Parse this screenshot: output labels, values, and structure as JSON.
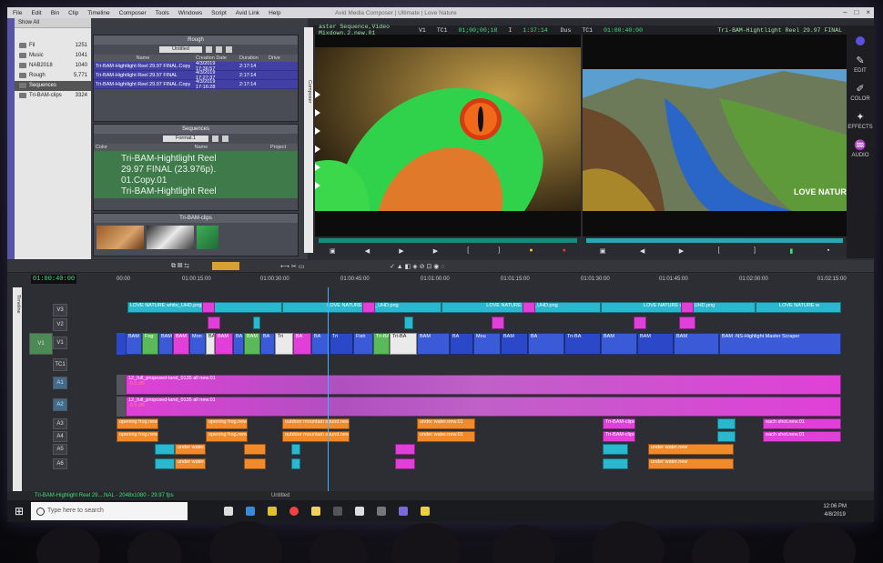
{
  "menu": [
    "File",
    "Edit",
    "Bin",
    "Clip",
    "Timeline",
    "Composer",
    "Tools",
    "Windows",
    "Script",
    "Avid Link",
    "Help"
  ],
  "window_title": "Avid Media Composer | Ultimate | Love Nature",
  "folders": {
    "show_all": "Show All",
    "items": [
      {
        "name": "Fil",
        "count": "1251"
      },
      {
        "name": "Music",
        "count": "1041"
      },
      {
        "name": "NAB2018",
        "count": "1040"
      },
      {
        "name": "Rough",
        "count": "5,771"
      },
      {
        "name": "Sequences",
        "count": ""
      },
      {
        "name": "Tri-BAM-clips",
        "count": "3324"
      }
    ]
  },
  "rough_bin": {
    "title": "Rough",
    "view": "Untitled",
    "columns": [
      "Name",
      "Creation Date",
      "Duration",
      "Drive"
    ],
    "rows": [
      {
        "name": "Tri-BAM-Hightlight Reel 29.97 FINAL.Copy.02",
        "date": "4/3/2019 17:36:57",
        "duration": "2:17:14"
      },
      {
        "name": "Tri-BAM-Hightlight Reel 29.97 FINAL",
        "date": "4/3/2019 17:27:37",
        "duration": "2:17:14"
      },
      {
        "name": "Tri-BAM-Hightlight Reel 29.97 FINAL.Copy.01",
        "date": "4/3/2019 17:16:28",
        "duration": "2:17:14"
      }
    ]
  },
  "sequences_bin": {
    "title": "Sequences",
    "view": "Format.1",
    "columns": [
      "Color",
      "Name",
      "Project"
    ],
    "selected_lines": [
      "Tri-BAM-Hightlight Reel",
      "29.97 FINAL (23.976p).",
      "01.Copy.01",
      "Tri-BAM-Hightlight Reel"
    ]
  },
  "clips_bin": {
    "title": "Tri-BAM-clips"
  },
  "composer_label": "Composer",
  "monitor_bar": {
    "source_seq": "aster Sequence,Video Mixdown,2.new.01",
    "v1": "V1",
    "tc1": "TC1",
    "source_tc": "01;00;00;18",
    "dur_label": "I",
    "duration": "1:37:14",
    "dur_label2": "Dus",
    "tc1b": "TC1",
    "record_tc": "01:00:40:00",
    "record_seq": "Tri-BAM-Hightlight Reel 29.97 FINAL"
  },
  "record_watermark": "LOVE NATURE",
  "sidebar": [
    {
      "label": "EDIT",
      "icon": "edit-icon",
      "glyph": "✎"
    },
    {
      "label": "COLOR",
      "icon": "color-icon",
      "glyph": "✐"
    },
    {
      "label": "EFFECTS",
      "icon": "effects-icon",
      "glyph": "✦"
    },
    {
      "label": "AUDIO",
      "icon": "audio-icon",
      "glyph": "♒"
    }
  ],
  "timeline": {
    "label": "Timeline",
    "timecode": "01:00:40:00",
    "ruler": [
      "00:00",
      "01:00:15:00",
      "01:00:30:00",
      "01:00:45:00",
      "01:01:00:00",
      "01:01:15:00",
      "01:01:30:00",
      "01:01:45:00",
      "01:02:00:00",
      "01:02:15:00"
    ],
    "tracks": [
      "V3",
      "V2",
      "V1",
      "TC1",
      "A1",
      "A2",
      "A3",
      "A4",
      "A5",
      "A6"
    ],
    "v3_titles": [
      "LOVE NATURE white_UHD.png",
      "LOVE NATURE white_UHD.png",
      "LOVE NATURE white_UHD.png",
      "LOVE NATURE white_UHD.png",
      "LOVE NATURE w"
    ],
    "audio_name": "12_full_proposed-land_0135 all new.01",
    "audio_gain": "-9.5 dB",
    "v1_labels": [
      "BAM",
      "Fog",
      "BAM",
      "BAM",
      "Mon",
      "BA",
      "BAM",
      "BA",
      "BAM",
      "BA",
      "Tri",
      "BA",
      "BA",
      "Tri",
      "Fish",
      "Tri-BA",
      "Tri-BA",
      "BAM",
      "BA",
      "Mou",
      "BAM",
      "BA",
      "Tri-BA",
      "BAM",
      "BAM",
      "BAM",
      "BAM -NS-Highlight Master Scraper"
    ],
    "a3_clip": "opening frog.new.01",
    "a3_clip2": "outdoor mountain sound.new",
    "a3_clip3": "under water.new.01",
    "a3_clip4": "Tri-BAM-clips",
    "a3_clip5": "each shot.new.01",
    "a5_clip": "under water.new"
  },
  "status_text": "Tri-BAM-Highlight Reel 29....NAL - 2048x1080 - 29.97 fps",
  "status_right": "Untitled",
  "taskbar": {
    "search_placeholder": "Type here to search",
    "time": "12:06 PM",
    "date": "4/8/2019"
  },
  "colors": {
    "accent_green": "#3fe07a",
    "bin_blue": "#4240a5",
    "seq_green": "#3f7a4a",
    "v3_cyan": "#2ab8cf",
    "v1_blue": "#3a5ad8",
    "audio_magenta": "#e040d8",
    "audio_orange": "#f08a2a"
  }
}
